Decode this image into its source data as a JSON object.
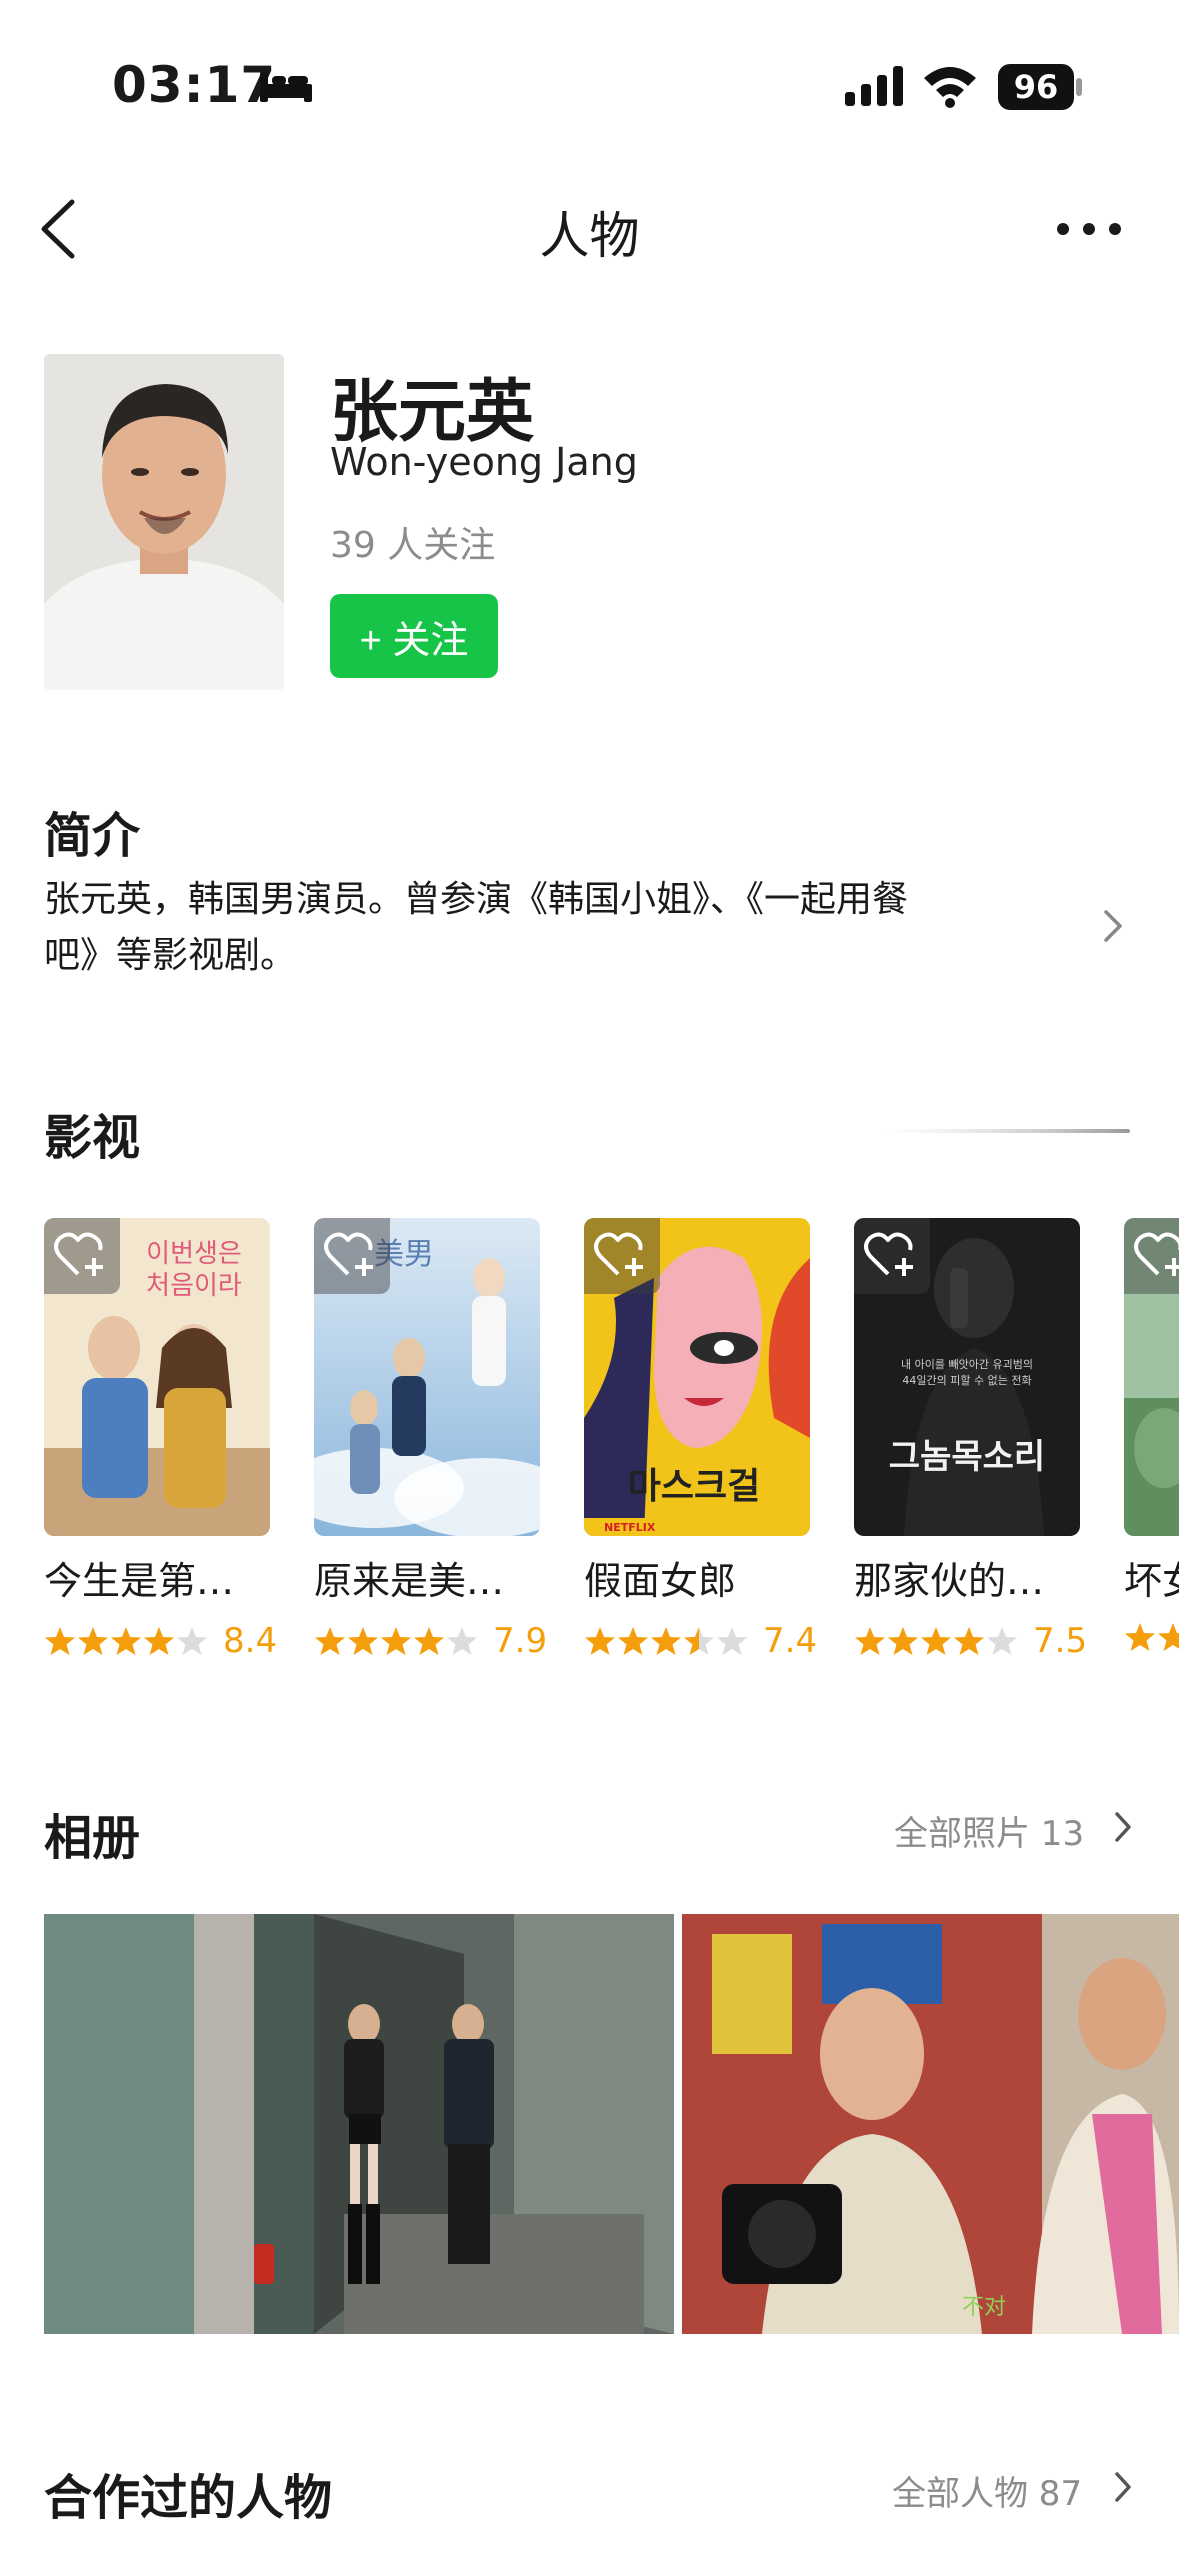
{
  "status_bar": {
    "time": "03:17",
    "battery": "96"
  },
  "nav": {
    "title": "人物"
  },
  "profile": {
    "name_cn": "张元英",
    "name_en": "Won-yeong Jang",
    "followers": "39 人关注",
    "follow_label": "+ 关注"
  },
  "intro": {
    "title": "简介",
    "line1": "张元英，韩国男演员。曾参演《韩国小姐》、《一起用餐",
    "line2": "吧》等影视剧。"
  },
  "films": {
    "title": "影视",
    "items": [
      {
        "title": "今生是第…",
        "rating": "8.4",
        "stars": 4
      },
      {
        "title": "原来是美…",
        "rating": "7.9",
        "stars": 4
      },
      {
        "title": "假面女郎",
        "rating": "7.4",
        "stars": 3.5
      },
      {
        "title": "那家伙的…",
        "rating": "7.5",
        "stars": 4
      },
      {
        "title": "坏女",
        "rating": "",
        "stars": 2
      }
    ]
  },
  "album": {
    "title": "相册",
    "more": "全部照片 13"
  },
  "collaborators": {
    "title": "合作过的人物",
    "more": "全部人物 87"
  },
  "colors": {
    "accent_green": "#16c447",
    "star_orange": "#f59e0b",
    "muted_text": "#8c8c8c"
  }
}
